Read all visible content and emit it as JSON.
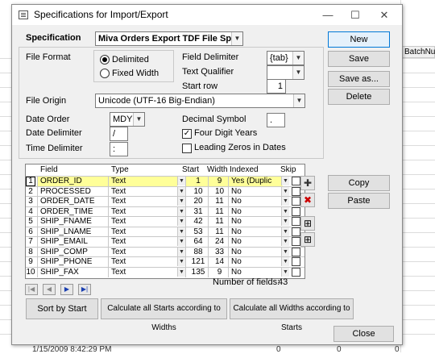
{
  "background": {
    "batch_header": "BatchNu",
    "bottom_text": "1/15/2009 8:42:29 PM",
    "bottom_zero1": "0",
    "bottom_zero2": "0",
    "bottom_zero3": "0"
  },
  "window": {
    "title": "Specifications for Import/Export",
    "minimize": "—",
    "maximize": "☐",
    "close": "✕"
  },
  "spec": {
    "label": "Specification",
    "value": "Miva Orders Export TDF File Spec"
  },
  "buttons": {
    "new": "New",
    "save": "Save",
    "save_as": "Save as...",
    "delete": "Delete",
    "copy": "Copy",
    "paste": "Paste",
    "sort_by_start": "Sort by Start",
    "calc_starts": "Calculate all Starts according to Widths",
    "calc_widths": "Calculate all Widths according to Starts",
    "close": "Close"
  },
  "file_format": {
    "label": "File Format",
    "delimited": "Delimited",
    "fixed_width": "Fixed Width",
    "selected": "Delimited"
  },
  "delimiters": {
    "field_delimiter_label": "Field Delimiter",
    "field_delimiter_value": "{tab}",
    "text_qualifier_label": "Text Qualifier",
    "text_qualifier_value": "",
    "start_row_label": "Start row",
    "start_row_value": "1"
  },
  "file_origin": {
    "label": "File Origin",
    "value": "Unicode (UTF-16 Big-Endian)"
  },
  "dates": {
    "date_order_label": "Date Order",
    "date_order_value": "MDY",
    "date_delimiter_label": "Date Delimiter",
    "date_delimiter_value": "/",
    "time_delimiter_label": "Time Delimiter",
    "time_delimiter_value": ":",
    "decimal_symbol_label": "Decimal Symbol",
    "decimal_symbol_value": ".",
    "four_digit_years_label": "Four Digit Years",
    "four_digit_years_checked": true,
    "leading_zeros_label": "Leading Zeros in Dates",
    "leading_zeros_checked": false
  },
  "grid": {
    "columns": [
      "Field",
      "Type",
      "Start",
      "Width",
      "Indexed",
      "Skip"
    ],
    "rows": [
      {
        "num": "1",
        "field": "ORDER_ID",
        "type": "Text",
        "start": "1",
        "width": "9",
        "indexed": "Yes (Duplic"
      },
      {
        "num": "2",
        "field": "PROCESSED",
        "type": "Text",
        "start": "10",
        "width": "10",
        "indexed": "No"
      },
      {
        "num": "3",
        "field": "ORDER_DATE",
        "type": "Text",
        "start": "20",
        "width": "11",
        "indexed": "No"
      },
      {
        "num": "4",
        "field": "ORDER_TIME",
        "type": "Text",
        "start": "31",
        "width": "11",
        "indexed": "No"
      },
      {
        "num": "5",
        "field": "SHIP_FNAME",
        "type": "Text",
        "start": "42",
        "width": "11",
        "indexed": "No"
      },
      {
        "num": "6",
        "field": "SHIP_LNAME",
        "type": "Text",
        "start": "53",
        "width": "11",
        "indexed": "No"
      },
      {
        "num": "7",
        "field": "SHIP_EMAIL",
        "type": "Text",
        "start": "64",
        "width": "24",
        "indexed": "No"
      },
      {
        "num": "8",
        "field": "SHIP_COMP",
        "type": "Text",
        "start": "88",
        "width": "33",
        "indexed": "No"
      },
      {
        "num": "9",
        "field": "SHIP_PHONE",
        "type": "Text",
        "start": "121",
        "width": "14",
        "indexed": "No"
      },
      {
        "num": "10",
        "field": "SHIP_FAX",
        "type": "Text",
        "start": "135",
        "width": "9",
        "indexed": "No"
      }
    ]
  },
  "number_of_fields": {
    "label": "Number of fields:",
    "value": "43"
  }
}
